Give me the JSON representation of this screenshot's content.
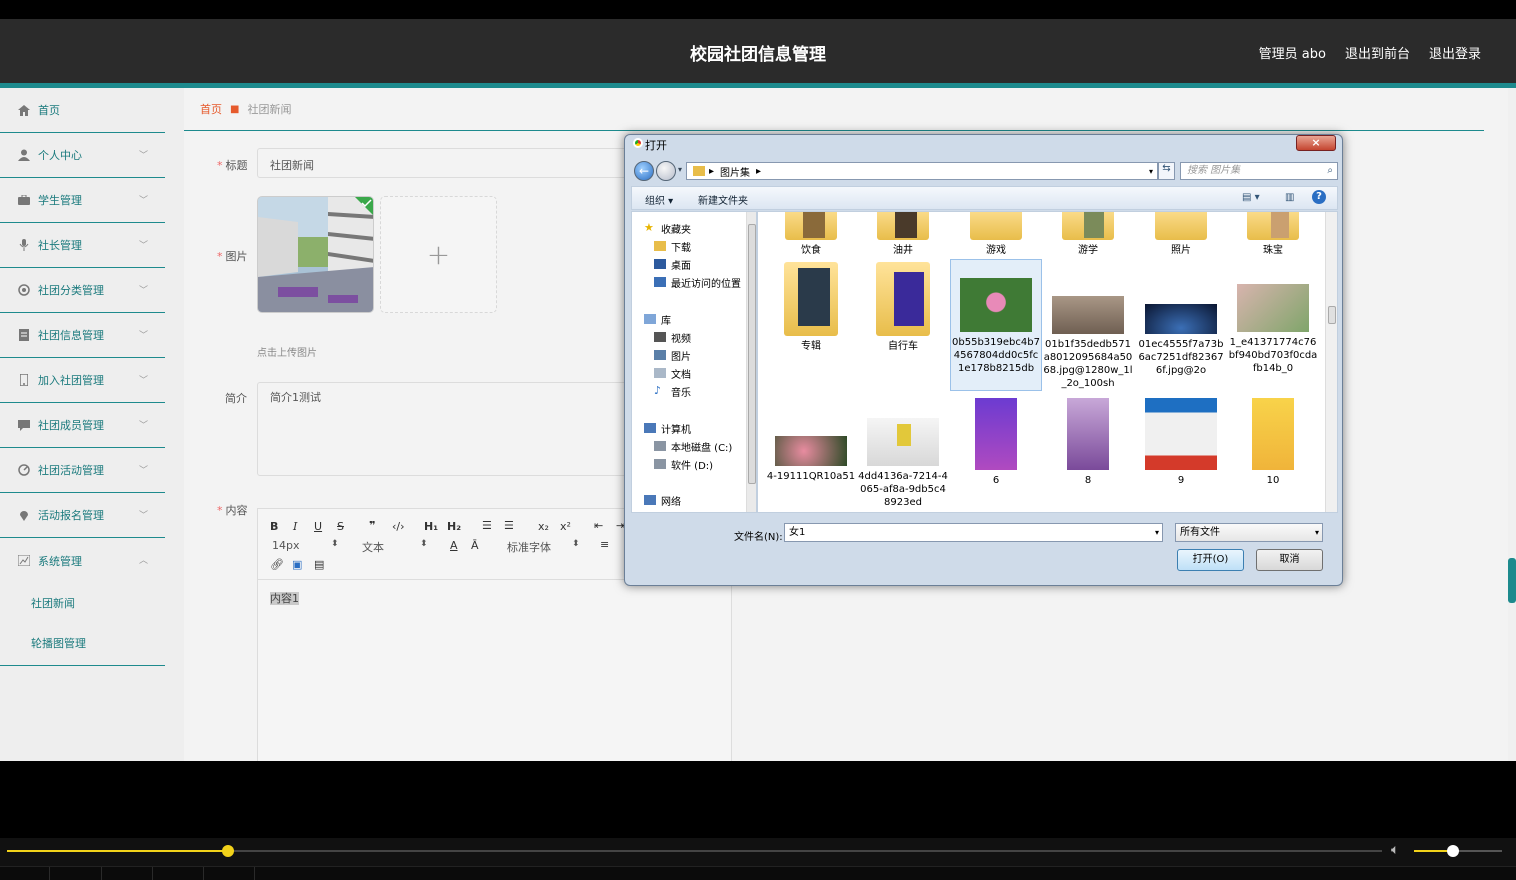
{
  "header": {
    "title": "校园社团信息管理",
    "admin": "管理员 abo",
    "to_front": "退出到前台",
    "logout": "退出登录"
  },
  "sidebar": {
    "items": [
      {
        "label": "首页",
        "icon": "home-icon"
      },
      {
        "label": "个人中心",
        "icon": "user-icon"
      },
      {
        "label": "学生管理",
        "icon": "briefcase-icon"
      },
      {
        "label": "社长管理",
        "icon": "microphone-icon"
      },
      {
        "label": "社团分类管理",
        "icon": "target-icon"
      },
      {
        "label": "社团信息管理",
        "icon": "document-icon"
      },
      {
        "label": "加入社团管理",
        "icon": "phone-icon"
      },
      {
        "label": "社团成员管理",
        "icon": "comment-icon"
      },
      {
        "label": "社团活动管理",
        "icon": "dashboard-icon"
      },
      {
        "label": "活动报名管理",
        "icon": "location-icon"
      },
      {
        "label": "系统管理",
        "icon": "chart-icon"
      }
    ],
    "sub_items": [
      {
        "label": "社团新闻"
      },
      {
        "label": "轮播图管理"
      }
    ]
  },
  "breadcrumb": {
    "home": "首页",
    "current": "社团新闻"
  },
  "form": {
    "title_label": "标题",
    "title_value": "社团新闻",
    "image_label": "图片",
    "upload_hint": "点击上传图片",
    "intro_label": "简介",
    "intro_value": "简介1测试",
    "content_label": "内容",
    "content_value": "内容1"
  },
  "editor_toolbar": {
    "font_size": "14px",
    "block_type": "文本",
    "font_family": "标准字体"
  },
  "dialog": {
    "title": "打开",
    "close": "×",
    "path": "图片集",
    "search_placeholder": "搜索 图片集",
    "organize": "组织",
    "new_folder": "新建文件夹",
    "nav": {
      "favorites": "收藏夹",
      "downloads": "下载",
      "desktop": "桌面",
      "recent": "最近访问的位置",
      "libraries": "库",
      "videos": "视频",
      "pictures": "图片",
      "documents": "文档",
      "music": "音乐",
      "computer": "计算机",
      "disk_c": "本地磁盘 (C:)",
      "disk_d": "软件 (D:)",
      "network": "网络"
    },
    "files_row1": [
      "饮食",
      "油井",
      "游戏",
      "游学",
      "照片",
      "珠宝"
    ],
    "files_row2": [
      "专辑",
      "自行车",
      "0b55b319ebc4b74567804dd0c5fc1e178b8215db",
      "01b1f35dedb571a8012095684a5068.jpg@1280w_1l_2o_100sh",
      "01ec4555f7a73b6ac7251df823676f.jpg@2o",
      "1_e41371774c76bf940bd703f0cdafb14b_0"
    ],
    "files_row3": [
      "4-19111QR10a51",
      "4dd4136a-7214-4065-af8a-9db5c48923ed",
      "6",
      "8",
      "9",
      "10"
    ],
    "filename_label": "文件名(N):",
    "filename_value": "女1",
    "filetype": "所有文件",
    "open_button": "打开(O)",
    "cancel_button": "取消"
  },
  "player": {
    "progress": 0.161,
    "volume": 0.44
  },
  "colors": {
    "accent": "#1d8a8d",
    "topbar": "#2b2b2b",
    "breadcrumb_home": "#e65a2c",
    "player_accent": "#f2d21a"
  }
}
